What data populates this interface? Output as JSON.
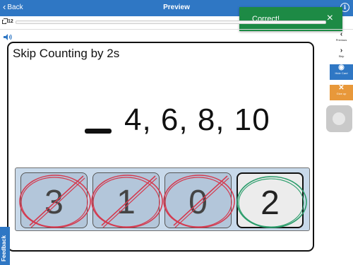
{
  "header": {
    "back_label": "Back",
    "title": "Preview",
    "info_icon": "info-icon"
  },
  "toast": {
    "message": "Correct!",
    "close_label": "×"
  },
  "progress": {
    "card_count": "12",
    "fraction": 0.0
  },
  "card": {
    "title": "Skip Counting by 2s",
    "sequence": "4, 6, 8, 10"
  },
  "answers": [
    {
      "value": "3",
      "state": "wrong"
    },
    {
      "value": "1",
      "state": "wrong"
    },
    {
      "value": "0",
      "state": "wrong"
    },
    {
      "value": "2",
      "state": "correct"
    }
  ],
  "sidebar": {
    "previous_label": "Previous",
    "skip_label": "Skip",
    "hide_card_label": "Hide Card",
    "give_up_label": "Give up"
  },
  "feedback": {
    "label": "Feedback"
  },
  "colors": {
    "header": "#2f77c4",
    "toast": "#1d8a45",
    "wrong_mark": "#d43a4f",
    "correct_mark": "#2a9d6b",
    "give_up": "#e8983a"
  }
}
